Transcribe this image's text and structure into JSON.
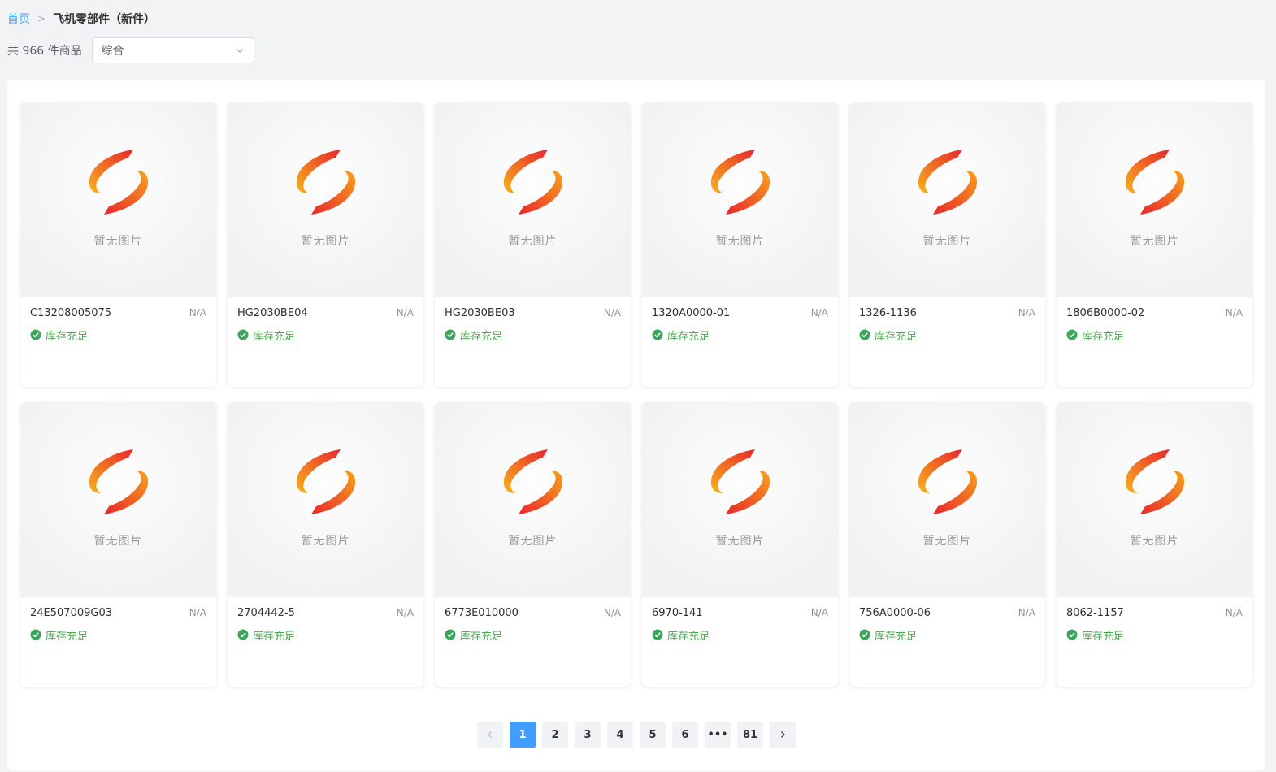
{
  "breadcrumb": {
    "home": "首页",
    "separator": ">",
    "current": "飞机零部件（新件）"
  },
  "toolbar": {
    "count_text": "共 966 件商品",
    "sort_select": {
      "value": "综合",
      "icon": "chevron-down-icon"
    }
  },
  "products": [
    {
      "part_no": "C13208005075",
      "price": "N/A",
      "stock": "库存充足",
      "placeholder": "暂无图片"
    },
    {
      "part_no": "HG2030BE04",
      "price": "N/A",
      "stock": "库存充足",
      "placeholder": "暂无图片"
    },
    {
      "part_no": "HG2030BE03",
      "price": "N/A",
      "stock": "库存充足",
      "placeholder": "暂无图片"
    },
    {
      "part_no": "1320A0000-01",
      "price": "N/A",
      "stock": "库存充足",
      "placeholder": "暂无图片"
    },
    {
      "part_no": "1326-1136",
      "price": "N/A",
      "stock": "库存充足",
      "placeholder": "暂无图片"
    },
    {
      "part_no": "1806B0000-02",
      "price": "N/A",
      "stock": "库存充足",
      "placeholder": "暂无图片"
    },
    {
      "part_no": "24E507009G03",
      "price": "N/A",
      "stock": "库存充足",
      "placeholder": "暂无图片"
    },
    {
      "part_no": "2704442-5",
      "price": "N/A",
      "stock": "库存充足",
      "placeholder": "暂无图片"
    },
    {
      "part_no": "6773E010000",
      "price": "N/A",
      "stock": "库存充足",
      "placeholder": "暂无图片"
    },
    {
      "part_no": "6970-141",
      "price": "N/A",
      "stock": "库存充足",
      "placeholder": "暂无图片"
    },
    {
      "part_no": "756A0000-06",
      "price": "N/A",
      "stock": "库存充足",
      "placeholder": "暂无图片"
    },
    {
      "part_no": "8062-1157",
      "price": "N/A",
      "stock": "库存充足",
      "placeholder": "暂无图片"
    }
  ],
  "pagination": {
    "prev_icon": "chevron-left-icon",
    "next_icon": "chevron-right-icon",
    "pages": [
      "1",
      "2",
      "3",
      "4",
      "5",
      "6",
      "•••",
      "81"
    ],
    "active": "1"
  },
  "colors": {
    "accent": "#409eff",
    "stock_green": "#4ca64f",
    "logo_orange": "#f5a623",
    "logo_red": "#e8262d"
  }
}
